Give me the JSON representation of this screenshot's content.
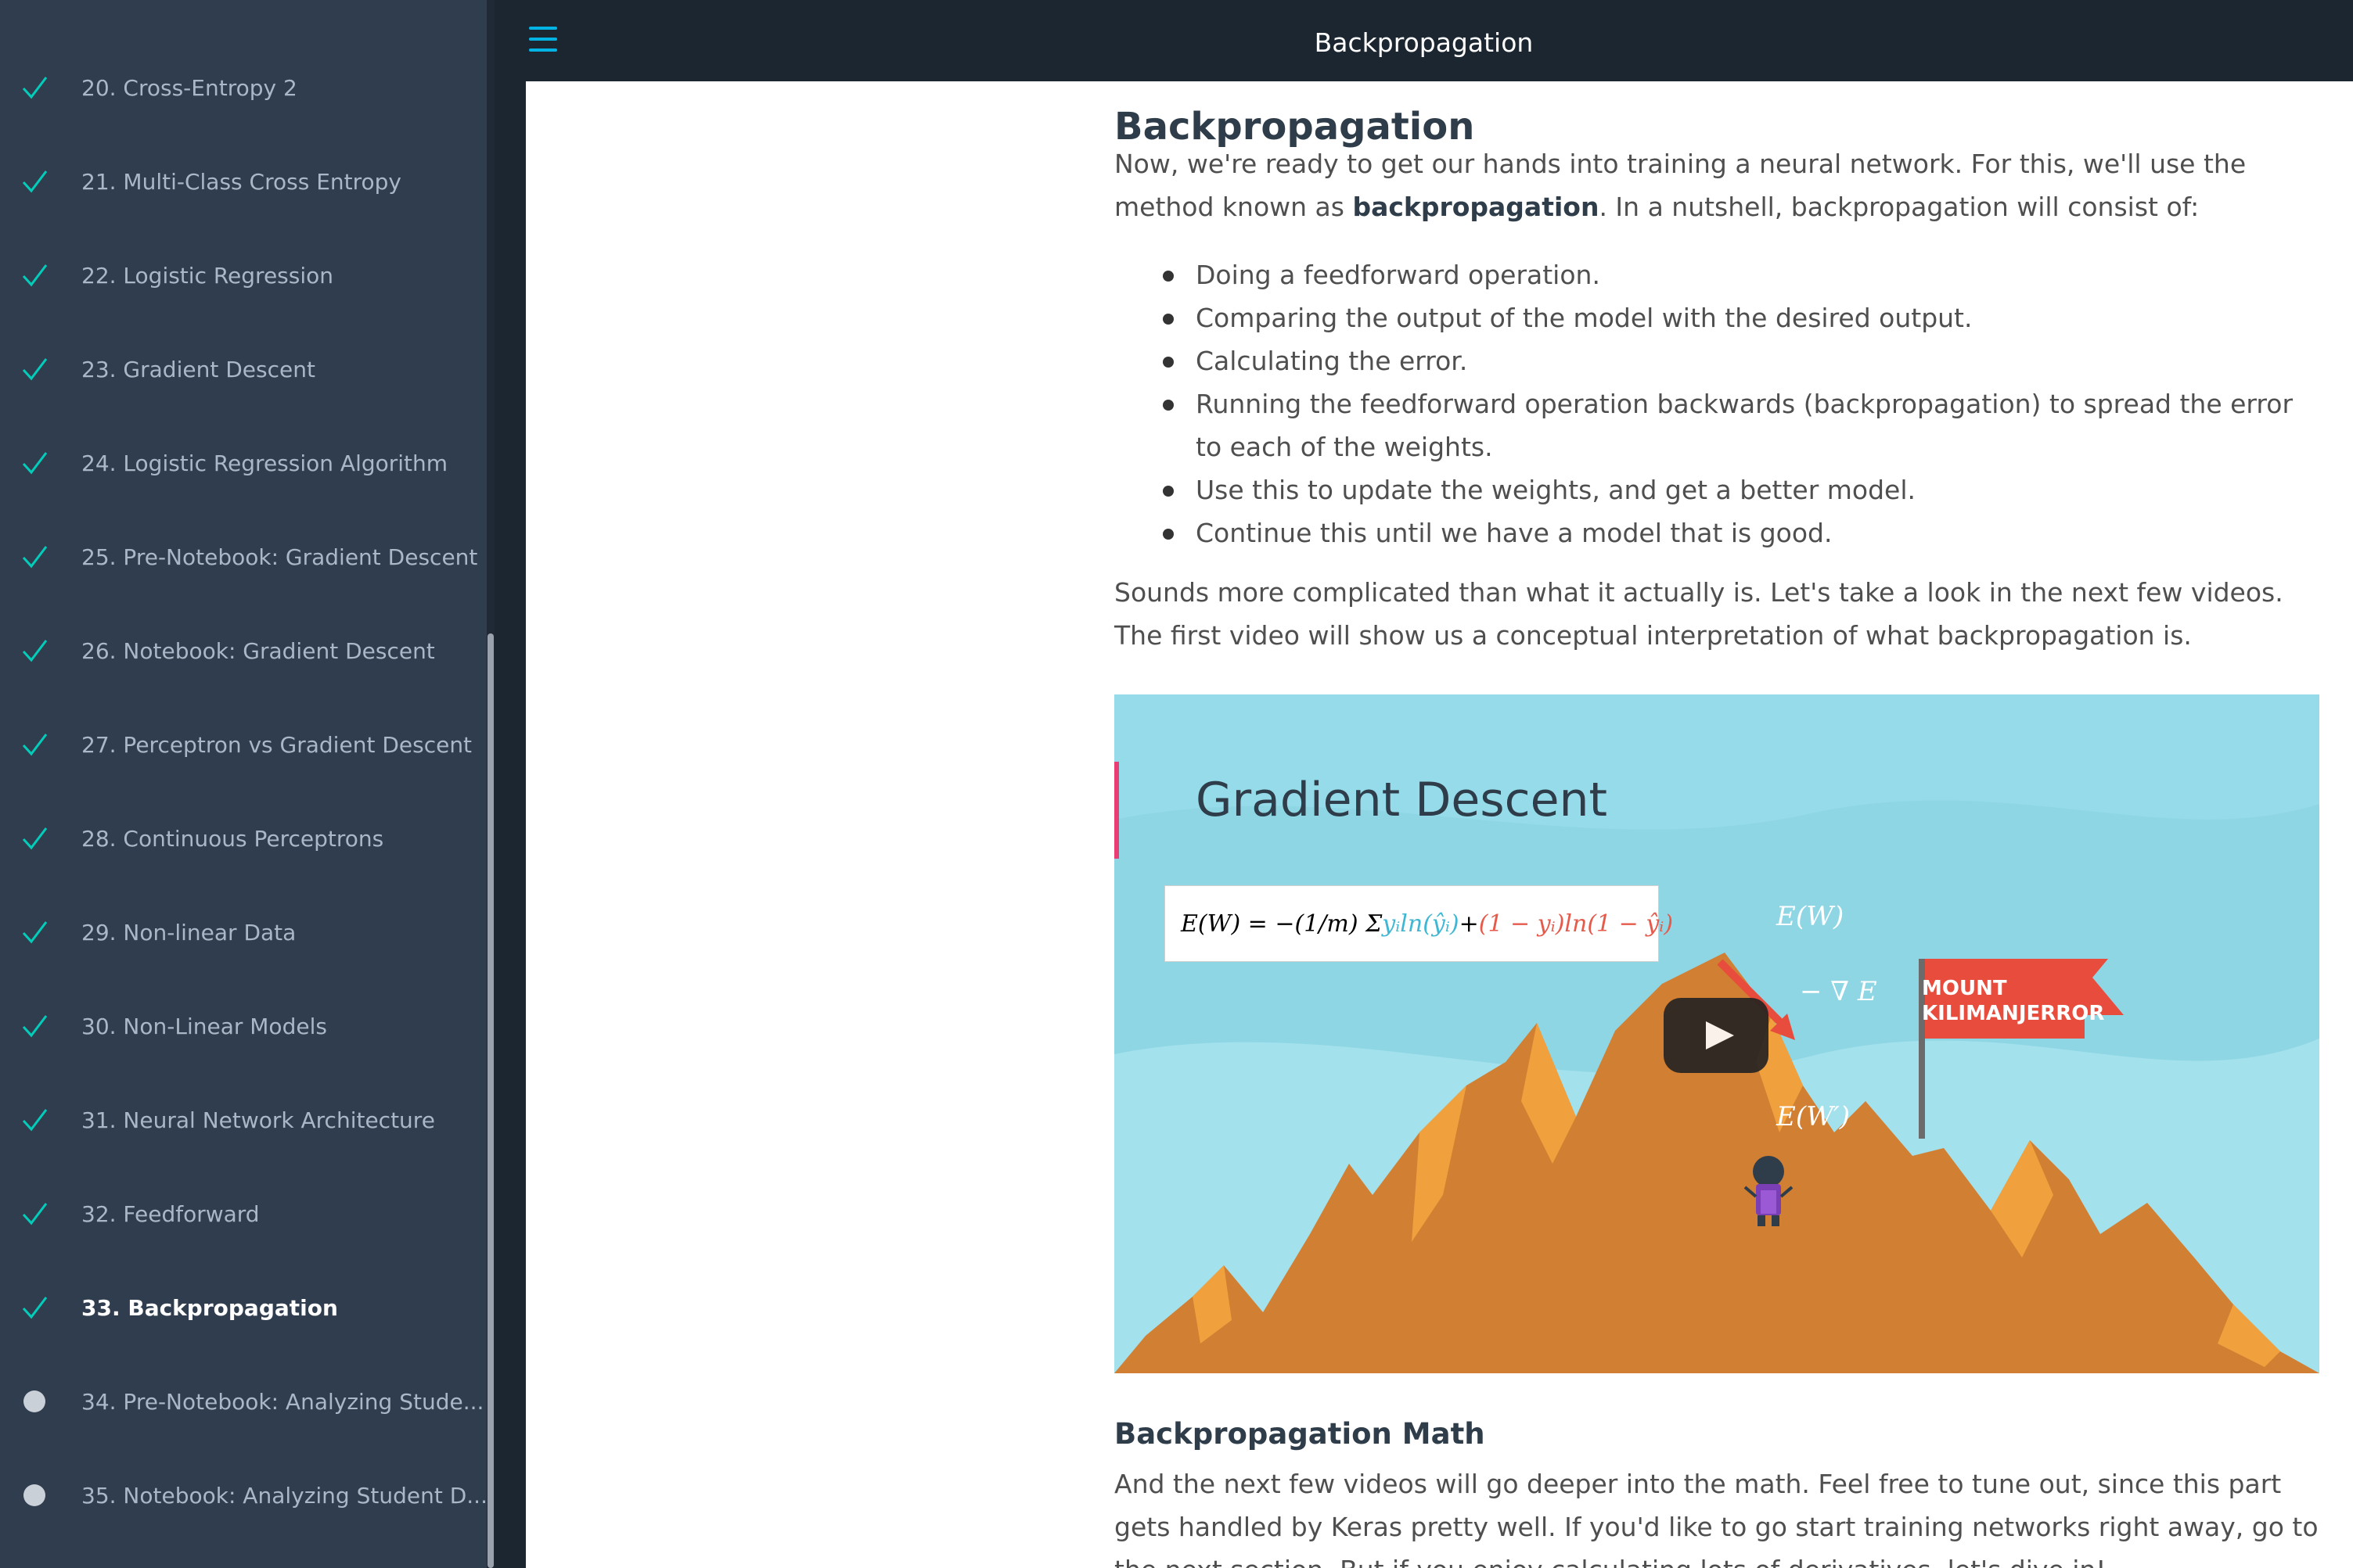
{
  "header": {
    "title": "Backpropagation"
  },
  "sidebar": {
    "items": [
      {
        "label": "20. Cross-Entropy 2",
        "status": "done"
      },
      {
        "label": "21. Multi-Class Cross Entropy",
        "status": "done"
      },
      {
        "label": "22. Logistic Regression",
        "status": "done"
      },
      {
        "label": "23. Gradient Descent",
        "status": "done"
      },
      {
        "label": "24. Logistic Regression Algorithm",
        "status": "done"
      },
      {
        "label": "25. Pre-Notebook: Gradient Descent",
        "status": "done"
      },
      {
        "label": "26. Notebook: Gradient Descent",
        "status": "done"
      },
      {
        "label": "27. Perceptron vs Gradient Descent",
        "status": "done"
      },
      {
        "label": "28. Continuous Perceptrons",
        "status": "done"
      },
      {
        "label": "29. Non-linear Data",
        "status": "done"
      },
      {
        "label": "30. Non-Linear Models",
        "status": "done"
      },
      {
        "label": "31. Neural Network Architecture",
        "status": "done"
      },
      {
        "label": "32. Feedforward",
        "status": "done"
      },
      {
        "label": "33. Backpropagation",
        "status": "done",
        "active": true
      },
      {
        "label": "34. Pre-Notebook: Analyzing Stude...",
        "status": "todo"
      },
      {
        "label": "35. Notebook: Analyzing Student D...",
        "status": "todo"
      }
    ]
  },
  "content": {
    "title": "Backpropagation",
    "intro_pre": "Now, we're ready to get our hands into training a neural network. For this, we'll use the method known as ",
    "intro_bold": "backpropagation",
    "intro_post": ". In a nutshell, backpropagation will consist of:",
    "steps": [
      "Doing a feedforward operation.",
      "Comparing the output of the model with the desired output.",
      "Calculating the error.",
      "Running the feedforward operation backwards (backpropagation) to spread the error to each of the weights.",
      "Use this to update the weights, and get a better model.",
      "Continue this until we have a model that is good."
    ],
    "followup": "Sounds more complicated than what it actually is. Let's take a look in the next few videos. The first video will show us a conceptual interpretation of what backpropagation is.",
    "video": {
      "title": "Gradient Descent",
      "formula_left": "E(W) = −(1/m) Σ ",
      "formula_blue": "yᵢln(ŷᵢ)",
      "formula_plus": " + ",
      "formula_red": "(1 − yᵢ)ln(1 − ŷᵢ)",
      "label_ew": "E(W)",
      "label_grad": "− ∇ E",
      "label_ew_prime": "E(W′)",
      "flag_line1": "MOUNT",
      "flag_line2": "KILIMANJERROR"
    },
    "math_heading": "Backpropagation Math",
    "math_paragraph": "And the next few videos will go deeper into the math. Feel free to tune out, since this part gets handled by Keras pretty well. If you'd like to go start training networks right away, go to the next section. But if you enjoy calculating lots of derivatives, let's dive in!"
  },
  "colors": {
    "sidebar_bg": "#2f3d4e",
    "check": "#02ccba",
    "accent": "#02b3e4",
    "topbar_bg": "#1c2630"
  }
}
